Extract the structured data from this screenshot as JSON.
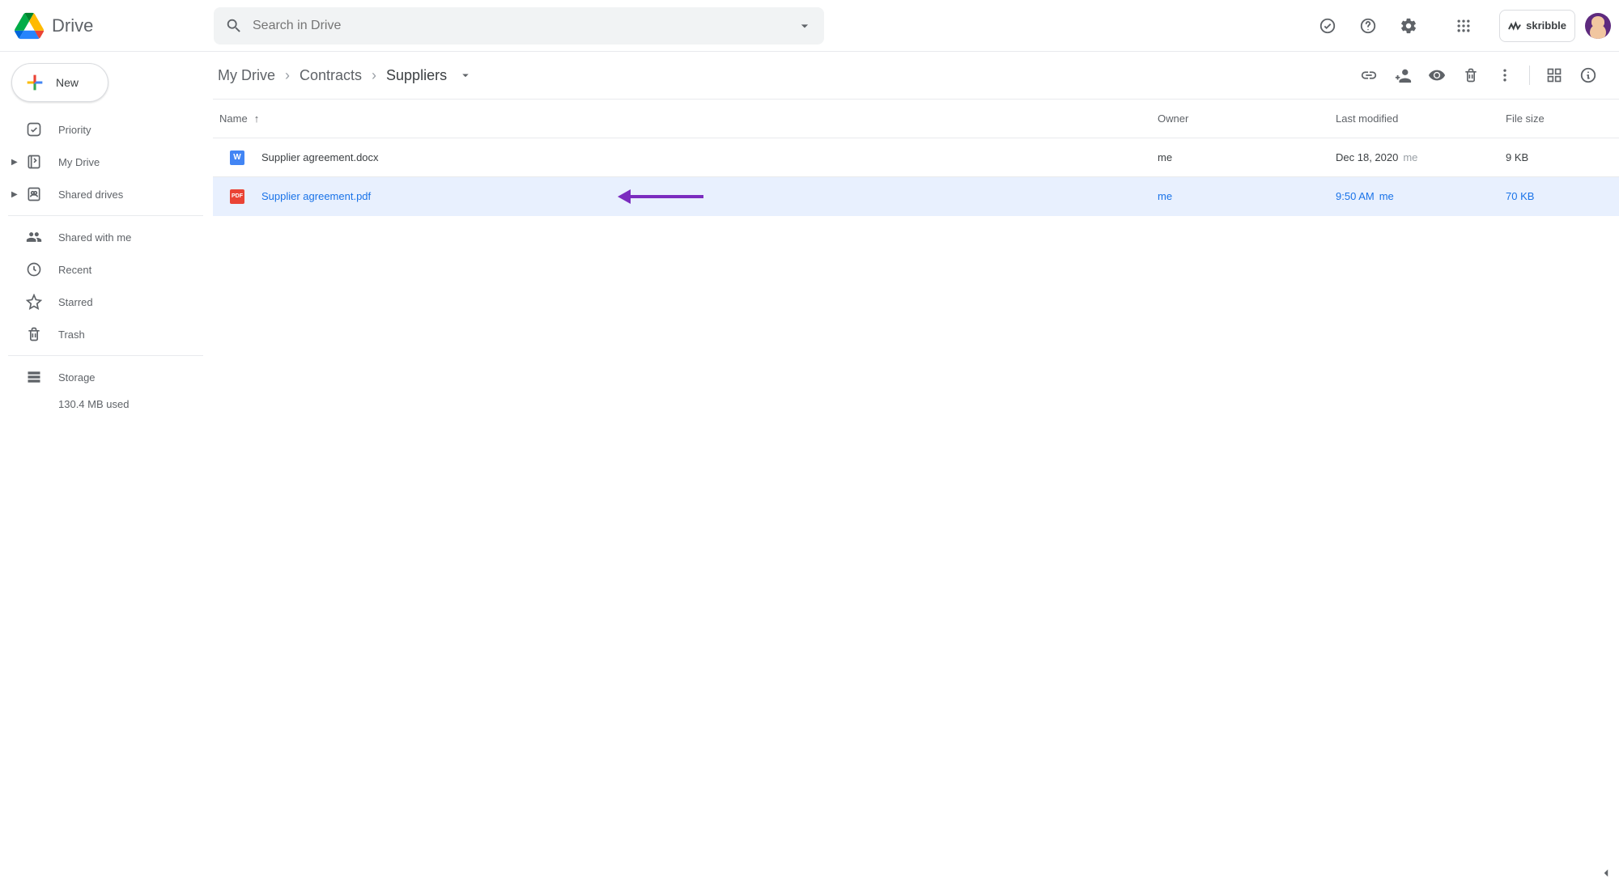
{
  "header": {
    "app_name": "Drive",
    "search_placeholder": "Search in Drive",
    "chip_label": "skribble"
  },
  "sidebar": {
    "new_label": "New",
    "items": [
      {
        "label": "Priority"
      },
      {
        "label": "My Drive"
      },
      {
        "label": "Shared drives"
      },
      {
        "label": "Shared with me"
      },
      {
        "label": "Recent"
      },
      {
        "label": "Starred"
      },
      {
        "label": "Trash"
      },
      {
        "label": "Storage"
      }
    ],
    "storage_used": "130.4 MB used"
  },
  "breadcrumb": {
    "c0": "My Drive",
    "c1": "Contracts",
    "c2": "Suppliers"
  },
  "table": {
    "h_name": "Name",
    "h_owner": "Owner",
    "h_modified": "Last modified",
    "h_size": "File size",
    "rows": [
      {
        "icon_letter": "W",
        "name": "Supplier agreement.docx",
        "owner": "me",
        "modified": "Dec 18, 2020",
        "modified_by": "me",
        "size": "9 KB"
      },
      {
        "icon_letter": "PDF",
        "name": "Supplier agreement.pdf",
        "owner": "me",
        "modified": "9:50 AM",
        "modified_by": "me",
        "size": "70 KB"
      }
    ]
  }
}
